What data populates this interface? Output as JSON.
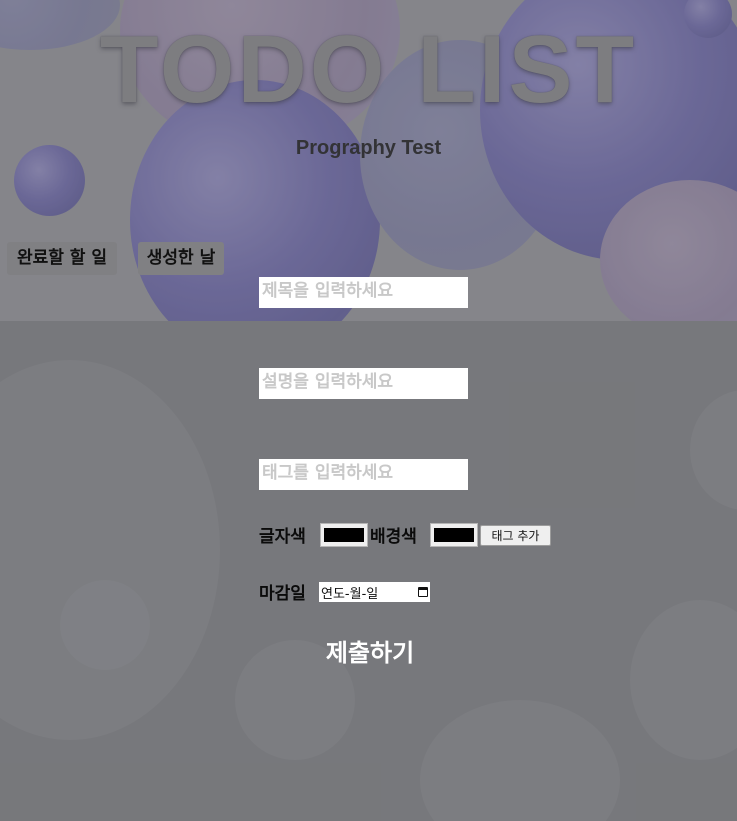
{
  "header": {
    "title": "TODO LIST",
    "subtitle": "Prography Test"
  },
  "sort_buttons": {
    "done_label": "완료할 할 일",
    "created_label": "생성한 날"
  },
  "form": {
    "title_placeholder": "제목을 입력하세요",
    "description_placeholder": "설명을 입력하세요",
    "tag_placeholder": "태그를 입력하세요",
    "text_color_label": "글자색",
    "text_color_value": "#000000",
    "bg_color_label": "배경색",
    "bg_color_value": "#000000",
    "add_tag_label": "태그 추가",
    "deadline_label": "마감일",
    "deadline_placeholder": "연도-월-일",
    "submit_label": "제출하기"
  },
  "colors": {
    "page_background": "#7a7b80",
    "bubble_purple": "#6a66a4",
    "submit_text": "#ffffff"
  },
  "icons": {
    "date_picker": "calendar-icon"
  }
}
